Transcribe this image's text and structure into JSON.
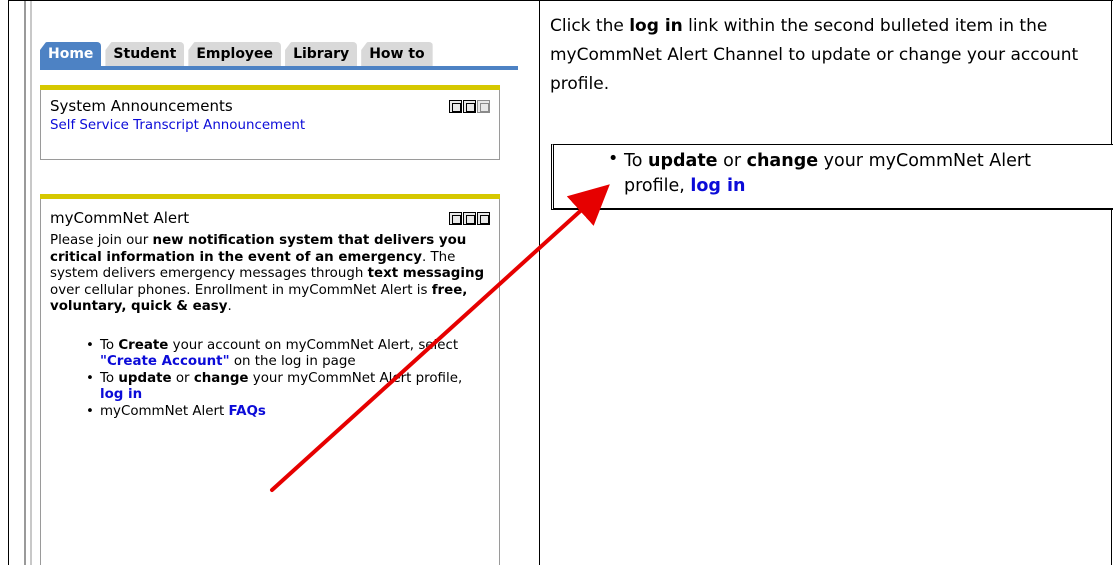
{
  "tabs": [
    {
      "label": "Home",
      "active": true
    },
    {
      "label": "Student",
      "active": false
    },
    {
      "label": "Employee",
      "active": false
    },
    {
      "label": "Library",
      "active": false
    },
    {
      "label": "How to",
      "active": false
    }
  ],
  "system_announcements": {
    "title": "System Announcements",
    "link": "Self Service Transcript Announcement"
  },
  "mycommnet_alert": {
    "title": "myCommNet Alert",
    "intro": {
      "p1": "Please join our ",
      "b1": "new notification system that delivers you critical information in the event of an emergency",
      "p2": ". The system delivers emergency messages through ",
      "b2": "text messaging",
      "p3": " over cellular phones. Enrollment in myCommNet Alert is ",
      "b3": "free, voluntary, quick & easy",
      "p4": "."
    },
    "bullets": {
      "create": {
        "pre": "To ",
        "bold": "Create",
        "mid": " your account on myCommNet Alert, select ",
        "link": "\"Create Account\"",
        "post": " on the log in page"
      },
      "update": {
        "pre": "To ",
        "bold1": "update",
        "mid1": " or ",
        "bold2": "change",
        "mid2": " your myCommNet Alert profile, ",
        "link": "log in"
      },
      "faq": {
        "pre": "myCommNet Alert ",
        "link": "FAQs"
      }
    }
  },
  "instruction": {
    "pre": "Click the ",
    "bold": "log in",
    "post": " link within the second bulleted item in the myCommNet Alert Channel to update or change your account profile."
  },
  "zoom": {
    "bullet": "•",
    "pre": "To ",
    "bold1": "update",
    "mid1": " or ",
    "bold2": "change",
    "mid2": " your myCommNet Alert profile, ",
    "link": "log in"
  },
  "colors": {
    "tab_active": "#4d82c4",
    "channel_bar": "#d6c800",
    "link": "#0b0bd8",
    "arrow": "#e60000"
  }
}
